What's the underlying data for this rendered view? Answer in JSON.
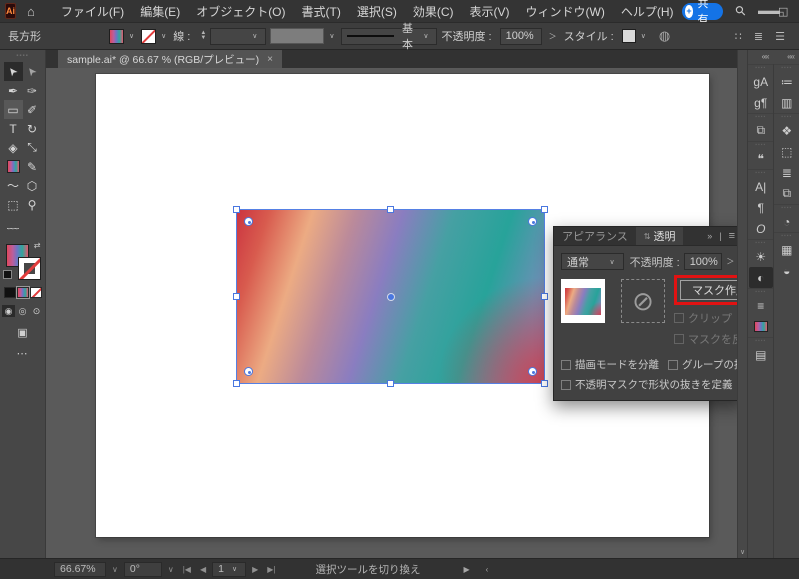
{
  "menubar": {
    "logo": "Ai",
    "home_icon": "⌂",
    "items": [
      "ファイル(F)",
      "編集(E)",
      "オブジェクト(O)",
      "書式(T)",
      "選択(S)",
      "効果(C)",
      "表示(V)",
      "ウィンドウ(W)",
      "ヘルプ(H)"
    ],
    "share_label": "共有",
    "share_avatar": "+",
    "search_icon": "⚲",
    "window_min": "—",
    "window_max": "□",
    "window_close": "✕"
  },
  "controlbar": {
    "shape_label": "長方形",
    "stroke_label": "線 :",
    "stepper_up": "▲",
    "stepper_down": "▼",
    "brush_label": "基本",
    "opacity_label": "不透明度 :",
    "opacity_value": "100%",
    "flyout": "＞",
    "style_label": "スタイル :",
    "recolor_icon": "◍",
    "grid_icon": "∷",
    "panel_icon": "≣",
    "menu_icon": "☰"
  },
  "ui": {
    "caret": "∨",
    "grip": "▪▪▪▪",
    "vscroll_down": "∨"
  },
  "doc_tab": {
    "title": "sample.ai* @ 66.67 % (RGB/プレビュー)",
    "close": "×"
  },
  "toolbar": {
    "tools": [
      {
        "name": "selection-tool",
        "glyph": "➤"
      },
      {
        "name": "direct-selection-tool",
        "glyph": "➤"
      },
      {
        "name": "pen-tool",
        "glyph": "✒"
      },
      {
        "name": "curvature-tool",
        "glyph": "✑"
      },
      {
        "name": "rectangle-tool",
        "glyph": "▭"
      },
      {
        "name": "paintbrush-tool",
        "glyph": "✐"
      },
      {
        "name": "type-tool",
        "glyph": "T"
      },
      {
        "name": "rotate-tool",
        "glyph": "↻"
      },
      {
        "name": "eraser-tool",
        "glyph": "◈"
      },
      {
        "name": "scale-tool",
        "glyph": "⤡"
      },
      {
        "name": "gradient-tool",
        "glyph": ""
      },
      {
        "name": "eyedropper-tool",
        "glyph": "✎"
      },
      {
        "name": "warp-tool",
        "glyph": "〜"
      },
      {
        "name": "shape-builder-tool",
        "glyph": "⬡"
      },
      {
        "name": "artboard-tool",
        "glyph": "⬚"
      },
      {
        "name": "zoom-tool",
        "glyph": "⚲"
      },
      {
        "name": "width-tool",
        "glyph": "﹏"
      }
    ],
    "swap_icon": "⇄",
    "draw_normal": "◉",
    "draw_behind": "◎",
    "draw_inside": "⊙",
    "screen_mode_icon": "▣",
    "more": "⋯"
  },
  "gradients": {
    "artwork": "radial-gradient(circle at 100% 100%, rgba(206,62,74,0.92) 0%, rgba(206,62,74,0) 30%), linear-gradient(108deg, #cb3440 0%, #d85b4e 9%, #ecab83 21%, #bb8a9a 33%, #8a7dc0 46%, #46a0a3 60%, #27a39a 76%, #6b90b5 90%, #8d84bd 100%)",
    "swatch": "linear-gradient(90deg, #e0485c 0%, #b95f9e 28%, #6f74c4 48%, #2fa79c 72%, #e05a70 100%)"
  },
  "panel": {
    "tab_appearance": "アピアランス",
    "tab_transparency": "透明",
    "cycle_icon": "⇅",
    "collapse_icon": "»",
    "divider": "|",
    "menu_icon": "≡",
    "blend_mode": "通常",
    "opacity_label": "不透明度 :",
    "opacity_value": "100%",
    "flyout": "＞",
    "mask_button": "マスク作成",
    "no_symbol": "⊘",
    "clip_label": "クリップ",
    "invert_label": "マスクを反転",
    "isolate_label": "描画モードを分離",
    "knockout_label": "グループの抜き",
    "define_label": "不透明マスクで形状の抜きを定義"
  },
  "dock": {
    "collapse": "«",
    "col1": [
      {
        "name": "glyphs-panel-icon",
        "glyph": "ɡA"
      },
      {
        "name": "paragraph-styles-icon",
        "glyph": "ɡ¶"
      },
      {
        "name": "symbols-icon",
        "glyph": "⧉"
      },
      {
        "name": "comments-icon",
        "glyph": "❝"
      },
      {
        "name": "character-icon",
        "glyph": "A|"
      },
      {
        "name": "paragraph-icon",
        "glyph": "¶"
      },
      {
        "name": "opentype-icon",
        "glyph": "O"
      },
      {
        "name": "appearance-icon",
        "glyph": "☀"
      },
      {
        "name": "transparency-icon",
        "glyph": "◐"
      },
      {
        "name": "stroke-icon",
        "glyph": "≡"
      },
      {
        "name": "gradient-icon",
        "glyph": ""
      },
      {
        "name": "libraries-icon",
        "glyph": "▤"
      }
    ],
    "col2": [
      {
        "name": "properties-icon",
        "glyph": "≔"
      },
      {
        "name": "libraries-book-icon",
        "glyph": "▥"
      },
      {
        "name": "layers-icon",
        "glyph": "❖"
      },
      {
        "name": "artboards-icon",
        "glyph": "⬚"
      },
      {
        "name": "align-icon",
        "glyph": "≣"
      },
      {
        "name": "pathfinder-icon",
        "glyph": "⧉"
      },
      {
        "name": "gradient-panel-icon",
        "glyph": "◔"
      },
      {
        "name": "swatches-icon",
        "glyph": "▦"
      },
      {
        "name": "color-icon",
        "glyph": "◒"
      }
    ]
  },
  "statusbar": {
    "zoom": "66.67%",
    "rotation": "0°",
    "first": "|◀",
    "prev": "◀",
    "artboard": "1",
    "next": "▶",
    "last": "▶|",
    "hint": "選択ツールを切り換え",
    "end_right": "▶",
    "end_left": "‹"
  },
  "colors": {
    "accent_blue": "#1473e6",
    "selection_blue": "#4a77e0",
    "annotation_red": "#e11212",
    "pasteboard": "#5a5a5a",
    "panel_bg": "#414141"
  }
}
